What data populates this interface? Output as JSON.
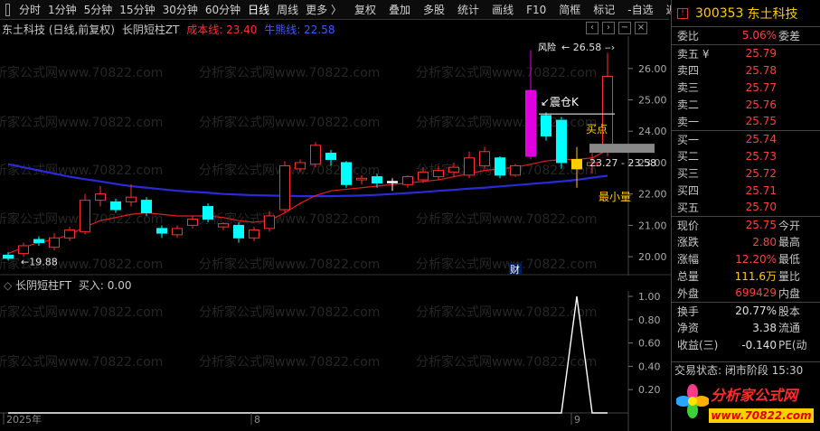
{
  "toolbar": {
    "tabs": [
      "分时",
      "1分钟",
      "5分钟",
      "15分钟",
      "30分钟",
      "60分钟",
      "日线",
      "周线",
      "更多 〉"
    ],
    "active_tab": "日线",
    "tools": [
      "复权",
      "叠加",
      "多股",
      "统计",
      "画线",
      "F10",
      "简框",
      "标记",
      "-自选",
      "返回"
    ]
  },
  "main_title": {
    "stock": "东土科技 (日线,前复权)",
    "indicator": "长阴短柱ZT",
    "cost_line": "成本线: 23.40",
    "bull_line": "牛熊线: 22.58"
  },
  "sub_title": {
    "indicator": "长阴短柱FT",
    "buy": "买入: 0.00"
  },
  "main_axis": [
    "26.00",
    "25.00",
    "24.00",
    "23.00",
    "22.00",
    "21.00",
    "20.00"
  ],
  "sub_axis": [
    "1.00",
    "0.80",
    "0.60",
    "0.40",
    "0.20"
  ],
  "annotations": {
    "high_label": "26.58",
    "low_label": "19.88",
    "pinned_label": "风险",
    "k_label": "震仓K",
    "buy_point": "买点",
    "min_volume": "最小量",
    "range_label": "23.27 - 23.58",
    "fin_marker": "财"
  },
  "x_labels": [
    "2025年",
    "8",
    "9"
  ],
  "watermark": "分析家公式网www.70822.com",
  "quote": {
    "code": "300353",
    "name": "东土科技",
    "weibi_label": "委比",
    "weibi": "5.06%",
    "weicha_label": "委差",
    "sells": [
      {
        "label": "卖五 ¥",
        "price": "25.79"
      },
      {
        "label": "卖四",
        "price": "25.78"
      },
      {
        "label": "卖三",
        "price": "25.77"
      },
      {
        "label": "卖二",
        "price": "25.76"
      },
      {
        "label": "卖一",
        "price": "25.75"
      }
    ],
    "buys": [
      {
        "label": "买一",
        "price": "25.74"
      },
      {
        "label": "买二",
        "price": "25.73"
      },
      {
        "label": "买三",
        "price": "25.72"
      },
      {
        "label": "买四",
        "price": "25.71"
      },
      {
        "label": "买五",
        "price": "25.70"
      }
    ],
    "stats": [
      {
        "l1": "现价",
        "v1": "25.75",
        "c1": "red",
        "l2": "今开"
      },
      {
        "l1": "涨跌",
        "v1": "2.80",
        "c1": "red",
        "l2": "最高"
      },
      {
        "l1": "涨幅",
        "v1": "12.20%",
        "c1": "red",
        "l2": "最低"
      },
      {
        "l1": "总量",
        "v1": "111.6万",
        "c1": "yellow",
        "l2": "量比"
      },
      {
        "l1": "外盘",
        "v1": "699429",
        "c1": "red",
        "l2": "内盘"
      }
    ],
    "stats2": [
      {
        "l1": "换手",
        "v1": "20.77%",
        "c1": "white",
        "l2": "股本"
      },
      {
        "l1": "净资",
        "v1": "3.38",
        "c1": "white",
        "l2": "流通"
      },
      {
        "l1": "收益(三)",
        "v1": "-0.140",
        "c1": "white",
        "l2": "PE(动"
      }
    ],
    "status": "交易状态: 闭市阶段 15:30"
  },
  "logo": {
    "title": "分析家公式网",
    "url": "www.70822.com"
  },
  "colors": {
    "up": "#ff3030",
    "down": "#00ffff",
    "magenta": "#e000e0",
    "yellow": "#ffcc00",
    "bull_line": "#2a2ad8",
    "cost_line": "#e02020"
  },
  "chart_data": {
    "type": "candlestick",
    "ylim": [
      19.6,
      26.8
    ],
    "candles": [
      {
        "o": 19.95,
        "c": 20.05,
        "h": 20.15,
        "l": 19.88,
        "k": "down"
      },
      {
        "o": 20.1,
        "c": 20.35,
        "h": 20.45,
        "l": 20.0,
        "k": "up"
      },
      {
        "o": 20.45,
        "c": 20.55,
        "h": 20.65,
        "l": 20.35,
        "k": "down"
      },
      {
        "o": 20.3,
        "c": 20.6,
        "h": 20.75,
        "l": 20.2,
        "k": "up"
      },
      {
        "o": 20.6,
        "c": 20.85,
        "h": 20.95,
        "l": 20.5,
        "k": "up"
      },
      {
        "o": 20.8,
        "c": 21.8,
        "h": 22.0,
        "l": 20.7,
        "k": "up"
      },
      {
        "o": 21.8,
        "c": 22.0,
        "h": 22.25,
        "l": 21.6,
        "k": "up"
      },
      {
        "o": 21.5,
        "c": 21.75,
        "h": 21.85,
        "l": 21.4,
        "k": "down"
      },
      {
        "o": 21.75,
        "c": 21.9,
        "h": 22.3,
        "l": 21.6,
        "k": "up"
      },
      {
        "o": 21.8,
        "c": 21.4,
        "h": 21.9,
        "l": 21.3,
        "k": "down"
      },
      {
        "o": 20.9,
        "c": 20.75,
        "h": 21.0,
        "l": 20.6,
        "k": "down"
      },
      {
        "o": 20.7,
        "c": 20.9,
        "h": 21.0,
        "l": 20.6,
        "k": "up"
      },
      {
        "o": 21.0,
        "c": 21.2,
        "h": 21.3,
        "l": 20.9,
        "k": "up"
      },
      {
        "o": 21.6,
        "c": 21.2,
        "h": 21.7,
        "l": 21.1,
        "k": "down"
      },
      {
        "o": 20.95,
        "c": 21.05,
        "h": 21.1,
        "l": 20.85,
        "k": "up"
      },
      {
        "o": 21.0,
        "c": 20.6,
        "h": 21.1,
        "l": 20.45,
        "k": "down"
      },
      {
        "o": 20.6,
        "c": 20.85,
        "h": 20.95,
        "l": 20.5,
        "k": "up"
      },
      {
        "o": 20.9,
        "c": 21.3,
        "h": 21.45,
        "l": 20.8,
        "k": "up"
      },
      {
        "o": 21.5,
        "c": 22.9,
        "h": 23.05,
        "l": 21.4,
        "k": "up"
      },
      {
        "o": 22.8,
        "c": 23.0,
        "h": 23.1,
        "l": 22.7,
        "k": "up"
      },
      {
        "o": 22.95,
        "c": 23.55,
        "h": 23.65,
        "l": 22.85,
        "k": "up"
      },
      {
        "o": 23.3,
        "c": 23.1,
        "h": 23.4,
        "l": 22.9,
        "k": "down"
      },
      {
        "o": 23.0,
        "c": 22.3,
        "h": 23.05,
        "l": 22.2,
        "k": "down"
      },
      {
        "o": 22.45,
        "c": 22.5,
        "h": 22.6,
        "l": 22.3,
        "k": "up"
      },
      {
        "o": 22.55,
        "c": 22.35,
        "h": 22.65,
        "l": 22.2,
        "k": "down"
      },
      {
        "o": 22.4,
        "c": 22.4,
        "h": 22.5,
        "l": 22.1,
        "k": "doji"
      },
      {
        "o": 22.3,
        "c": 22.55,
        "h": 22.6,
        "l": 22.2,
        "k": "up"
      },
      {
        "o": 22.45,
        "c": 22.7,
        "h": 22.85,
        "l": 22.35,
        "k": "up"
      },
      {
        "o": 22.55,
        "c": 22.75,
        "h": 22.9,
        "l": 22.45,
        "k": "up"
      },
      {
        "o": 22.7,
        "c": 22.85,
        "h": 23.0,
        "l": 22.55,
        "k": "up"
      },
      {
        "o": 22.6,
        "c": 23.15,
        "h": 23.35,
        "l": 22.5,
        "k": "up"
      },
      {
        "o": 22.9,
        "c": 23.35,
        "h": 23.5,
        "l": 22.8,
        "k": "up"
      },
      {
        "o": 23.15,
        "c": 22.6,
        "h": 23.2,
        "l": 22.5,
        "k": "down"
      },
      {
        "o": 22.6,
        "c": 22.9,
        "h": 22.95,
        "l": 22.55,
        "k": "up"
      },
      {
        "o": 25.3,
        "c": 23.2,
        "h": 26.58,
        "l": 23.1,
        "k": "magenta"
      },
      {
        "o": 24.5,
        "c": 23.85,
        "h": 24.6,
        "l": 23.7,
        "k": "down"
      },
      {
        "o": 24.35,
        "c": 23.0,
        "h": 24.45,
        "l": 22.8,
        "k": "down"
      },
      {
        "o": 23.1,
        "c": 22.8,
        "h": 23.5,
        "l": 22.2,
        "k": "yellow"
      },
      {
        "o": 22.9,
        "c": 23.0,
        "h": 23.3,
        "l": 22.65,
        "k": "up"
      },
      {
        "o": 23.35,
        "c": 25.75,
        "h": 26.5,
        "l": 23.2,
        "k": "up"
      }
    ],
    "cost_line": [
      20.1,
      20.3,
      20.45,
      20.55,
      20.7,
      20.95,
      21.15,
      21.25,
      21.35,
      21.4,
      21.35,
      21.3,
      21.3,
      21.3,
      21.25,
      21.15,
      21.1,
      21.15,
      21.4,
      21.7,
      21.95,
      22.1,
      22.15,
      22.2,
      22.25,
      22.3,
      22.35,
      22.4,
      22.45,
      22.55,
      22.65,
      22.75,
      22.8,
      22.85,
      22.95,
      23.05,
      23.1,
      23.1,
      23.15,
      23.4
    ],
    "bull_line": [
      22.95,
      22.85,
      22.75,
      22.65,
      22.55,
      22.47,
      22.4,
      22.32,
      22.25,
      22.2,
      22.15,
      22.1,
      22.07,
      22.04,
      22.0,
      21.98,
      21.96,
      21.95,
      21.94,
      21.93,
      21.93,
      21.93,
      21.94,
      21.95,
      21.97,
      22.0,
      22.03,
      22.06,
      22.1,
      22.13,
      22.17,
      22.2,
      22.24,
      22.28,
      22.32,
      22.36,
      22.4,
      22.45,
      22.52,
      22.58
    ],
    "signal": [
      0,
      0,
      0,
      0,
      0,
      0,
      0,
      0,
      0,
      0,
      0,
      0,
      0,
      0,
      0,
      0,
      0,
      0,
      0,
      0,
      0,
      0,
      0,
      0,
      0,
      0,
      0,
      0,
      0,
      0,
      0,
      0,
      0,
      0,
      0,
      0,
      0,
      1,
      0,
      0
    ]
  }
}
